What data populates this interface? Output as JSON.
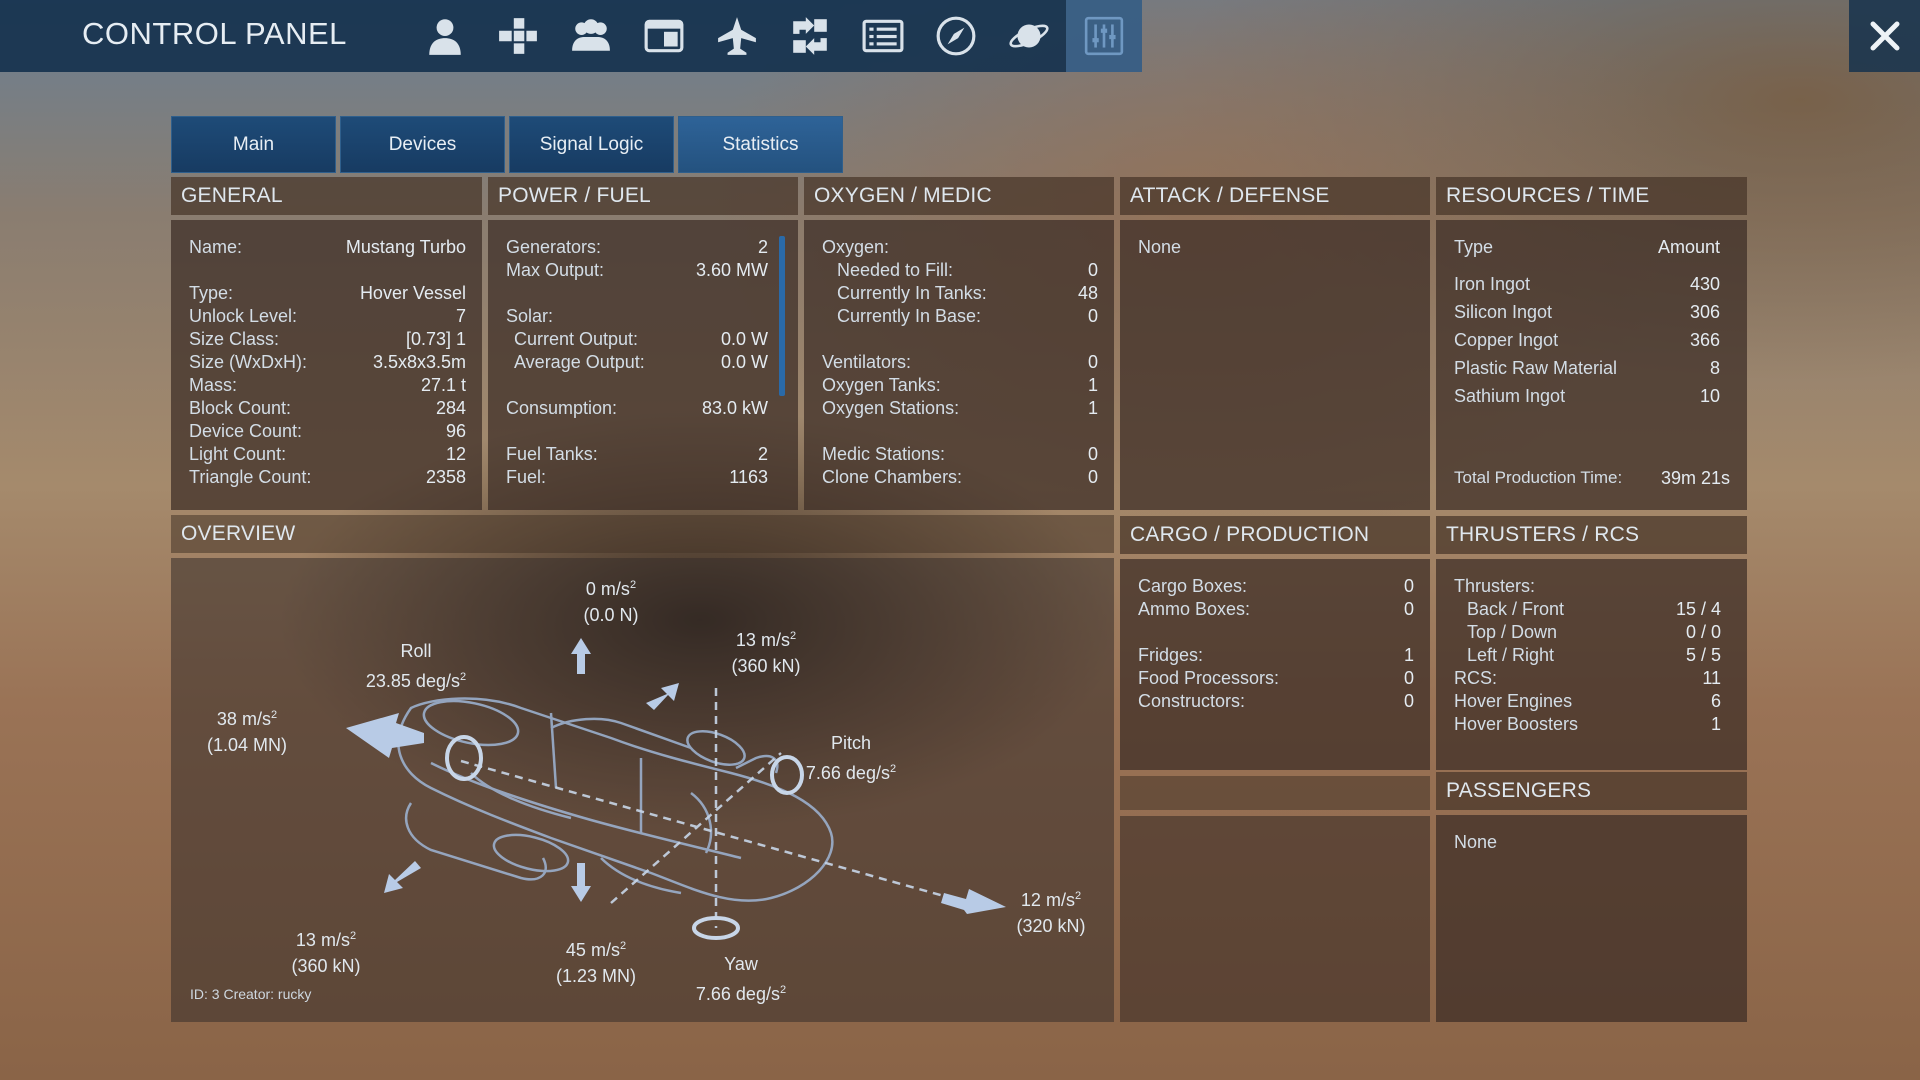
{
  "window": {
    "title": "CONTROL PANEL"
  },
  "toolbar": [
    {
      "name": "player-icon"
    },
    {
      "name": "structure-tree-icon"
    },
    {
      "name": "faction-icon"
    },
    {
      "name": "registry-icon"
    },
    {
      "name": "ship-icon"
    },
    {
      "name": "transfer-icon"
    },
    {
      "name": "list-icon"
    },
    {
      "name": "compass-icon"
    },
    {
      "name": "planet-icon"
    },
    {
      "name": "control-panel-icon"
    }
  ],
  "colors": {
    "accent": "#2e6398",
    "panel": "#3c2d26",
    "header": "#463428",
    "icon": "#d9e2ea"
  },
  "tabs": [
    {
      "label": "Main"
    },
    {
      "label": "Devices"
    },
    {
      "label": "Signal Logic"
    },
    {
      "label": "Statistics",
      "active": true
    }
  ],
  "general": {
    "title": "GENERAL",
    "rows": [
      {
        "k": "Name:",
        "v": "Mustang Turbo"
      },
      {
        "k": "Type:",
        "v": "Hover Vessel"
      },
      {
        "k": "Unlock Level:",
        "v": "7"
      },
      {
        "k": "Size Class:",
        "v": "[0.73]   1"
      },
      {
        "k": "Size (WxDxH):",
        "v": "3.5x8x3.5m"
      },
      {
        "k": "Mass:",
        "v": "27.1 t"
      },
      {
        "k": "Block Count:",
        "v": "284"
      },
      {
        "k": "Device Count:",
        "v": "96"
      },
      {
        "k": "Light Count:",
        "v": "12"
      },
      {
        "k": "Triangle Count:",
        "v": "2358"
      }
    ]
  },
  "power": {
    "title": "POWER / FUEL",
    "rows": [
      {
        "k": "Generators:",
        "v": "2"
      },
      {
        "k": "Max Output:",
        "v": "3.60 MW"
      },
      {
        "k": "Solar:",
        "v": ""
      },
      {
        "k": "  Current Output:",
        "v": "0.0 W"
      },
      {
        "k": "  Average Output:",
        "v": "0.0 W"
      },
      {
        "k": "Consumption:",
        "v": "83.0 kW"
      },
      {
        "k": "Fuel Tanks:",
        "v": "2"
      },
      {
        "k": "Fuel:",
        "v": "1163"
      }
    ]
  },
  "oxygen": {
    "title": "OXYGEN / MEDIC",
    "rows": [
      {
        "k": "Oxygen:",
        "v": ""
      },
      {
        "k": "  Needed to Fill:",
        "v": "0"
      },
      {
        "k": "  Currently In Tanks:",
        "v": "48"
      },
      {
        "k": "  Currently In Base:",
        "v": "0"
      },
      {
        "k": "Ventilators:",
        "v": "0"
      },
      {
        "k": "Oxygen Tanks:",
        "v": "1"
      },
      {
        "k": "Oxygen Stations:",
        "v": "1"
      },
      {
        "k": "Medic Stations:",
        "v": "0"
      },
      {
        "k": "Clone Chambers:",
        "v": "0"
      }
    ]
  },
  "attack": {
    "title": "ATTACK / DEFENSE",
    "none": "None"
  },
  "resources": {
    "title": "RESOURCES / TIME",
    "header_type": "Type",
    "header_amount": "Amount",
    "rows": [
      {
        "k": "Iron Ingot",
        "v": "430"
      },
      {
        "k": "Silicon Ingot",
        "v": "306"
      },
      {
        "k": "Copper Ingot",
        "v": "366"
      },
      {
        "k": "Plastic Raw Material",
        "v": "8"
      },
      {
        "k": "Sathium Ingot",
        "v": "10"
      }
    ],
    "total_label": "Total Production Time:",
    "total_value": "39m 21s"
  },
  "overview": {
    "title": "OVERVIEW",
    "up": {
      "accel": "0 m/s",
      "force": "(0.0 N)"
    },
    "roll": {
      "name": "Roll",
      "value": "23.85 deg/s"
    },
    "back": {
      "accel": "38 m/s",
      "force": "(1.04 MN)"
    },
    "up_right": {
      "accel": "13 m/s",
      "force": "(360 kN)"
    },
    "pitch": {
      "name": "Pitch",
      "value": "7.66 deg/s"
    },
    "front": {
      "accel": "12 m/s",
      "force": "(320 kN)"
    },
    "left": {
      "accel": "13 m/s",
      "force": "(360 kN)"
    },
    "down": {
      "accel": "45 m/s",
      "force": "(1.23 MN)"
    },
    "yaw": {
      "name": "Yaw",
      "value": "7.66 deg/s"
    },
    "sq": "2",
    "footer": "ID: 3  Creator: rucky"
  },
  "cargo": {
    "title": "CARGO / PRODUCTION",
    "rows": [
      {
        "k": "Cargo Boxes:",
        "v": "0"
      },
      {
        "k": "Ammo Boxes:",
        "v": "0"
      },
      {
        "k": "Fridges:",
        "v": "1"
      },
      {
        "k": "Food Processors:",
        "v": "0"
      },
      {
        "k": "Constructors:",
        "v": "0"
      }
    ]
  },
  "thrusters": {
    "title": "THRUSTERS / RCS",
    "rows": [
      {
        "k": "Thrusters:",
        "v": ""
      },
      {
        "k": "  Back / Front",
        "v": "15 / 4"
      },
      {
        "k": "  Top / Down",
        "v": "0 / 0"
      },
      {
        "k": "  Left / Right",
        "v": "5 / 5"
      },
      {
        "k": "RCS:",
        "v": "11"
      },
      {
        "k": "Hover Engines",
        "v": "6"
      },
      {
        "k": "Hover Boosters",
        "v": "1"
      }
    ]
  },
  "passengers": {
    "title": "PASSENGERS",
    "none": "None"
  }
}
